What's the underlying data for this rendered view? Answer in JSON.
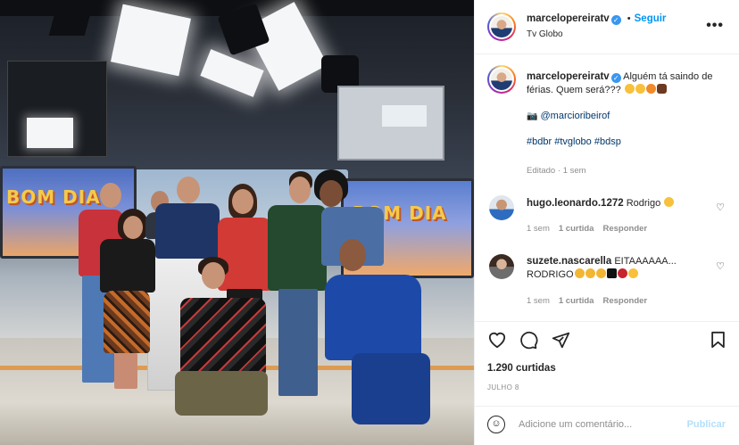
{
  "post": {
    "username": "marcelopereiratv",
    "follow_label": "Seguir",
    "location": "Tv Globo",
    "more_label": "•••",
    "verified_mark": "✓"
  },
  "photo": {
    "studio_sign_left": "BOM DIA",
    "studio_sign_right": "BOM DIA"
  },
  "caption": {
    "username": "marcelopereiratv",
    "text": "Alguém tá saindo de férias. Quem será???",
    "camera_glyph": "📷",
    "mention": "@marcioribeirof",
    "hashtags": [
      "#bdbr",
      "#tvglobo",
      "#bdsp"
    ],
    "edited_label": "Editado",
    "time": "1 sem"
  },
  "comments": [
    {
      "username": "hugo.leonardo.1272",
      "text": "Rodrigo",
      "time": "1 sem",
      "likes_label": "1 curtida",
      "reply_label": "Responder"
    },
    {
      "username": "suzete.nascarella",
      "text_line1": "EITAAAAAA...",
      "text_line2": "RODRIGO",
      "time": "1 sem",
      "likes_label": "1 curtida",
      "reply_label": "Responder"
    }
  ],
  "actions": {
    "like_icon": "heart-icon",
    "comment_icon": "comment-icon",
    "share_icon": "share-icon",
    "save_icon": "bookmark-icon"
  },
  "likes": "1.290 curtidas",
  "date": "JULHO 8",
  "add_comment": {
    "placeholder": "Adicione um comentário...",
    "publish_label": "Publicar"
  },
  "colors": {
    "link_blue": "#0095f6",
    "publish_disabled": "#b2dffc",
    "muted": "#8e8e8e"
  }
}
